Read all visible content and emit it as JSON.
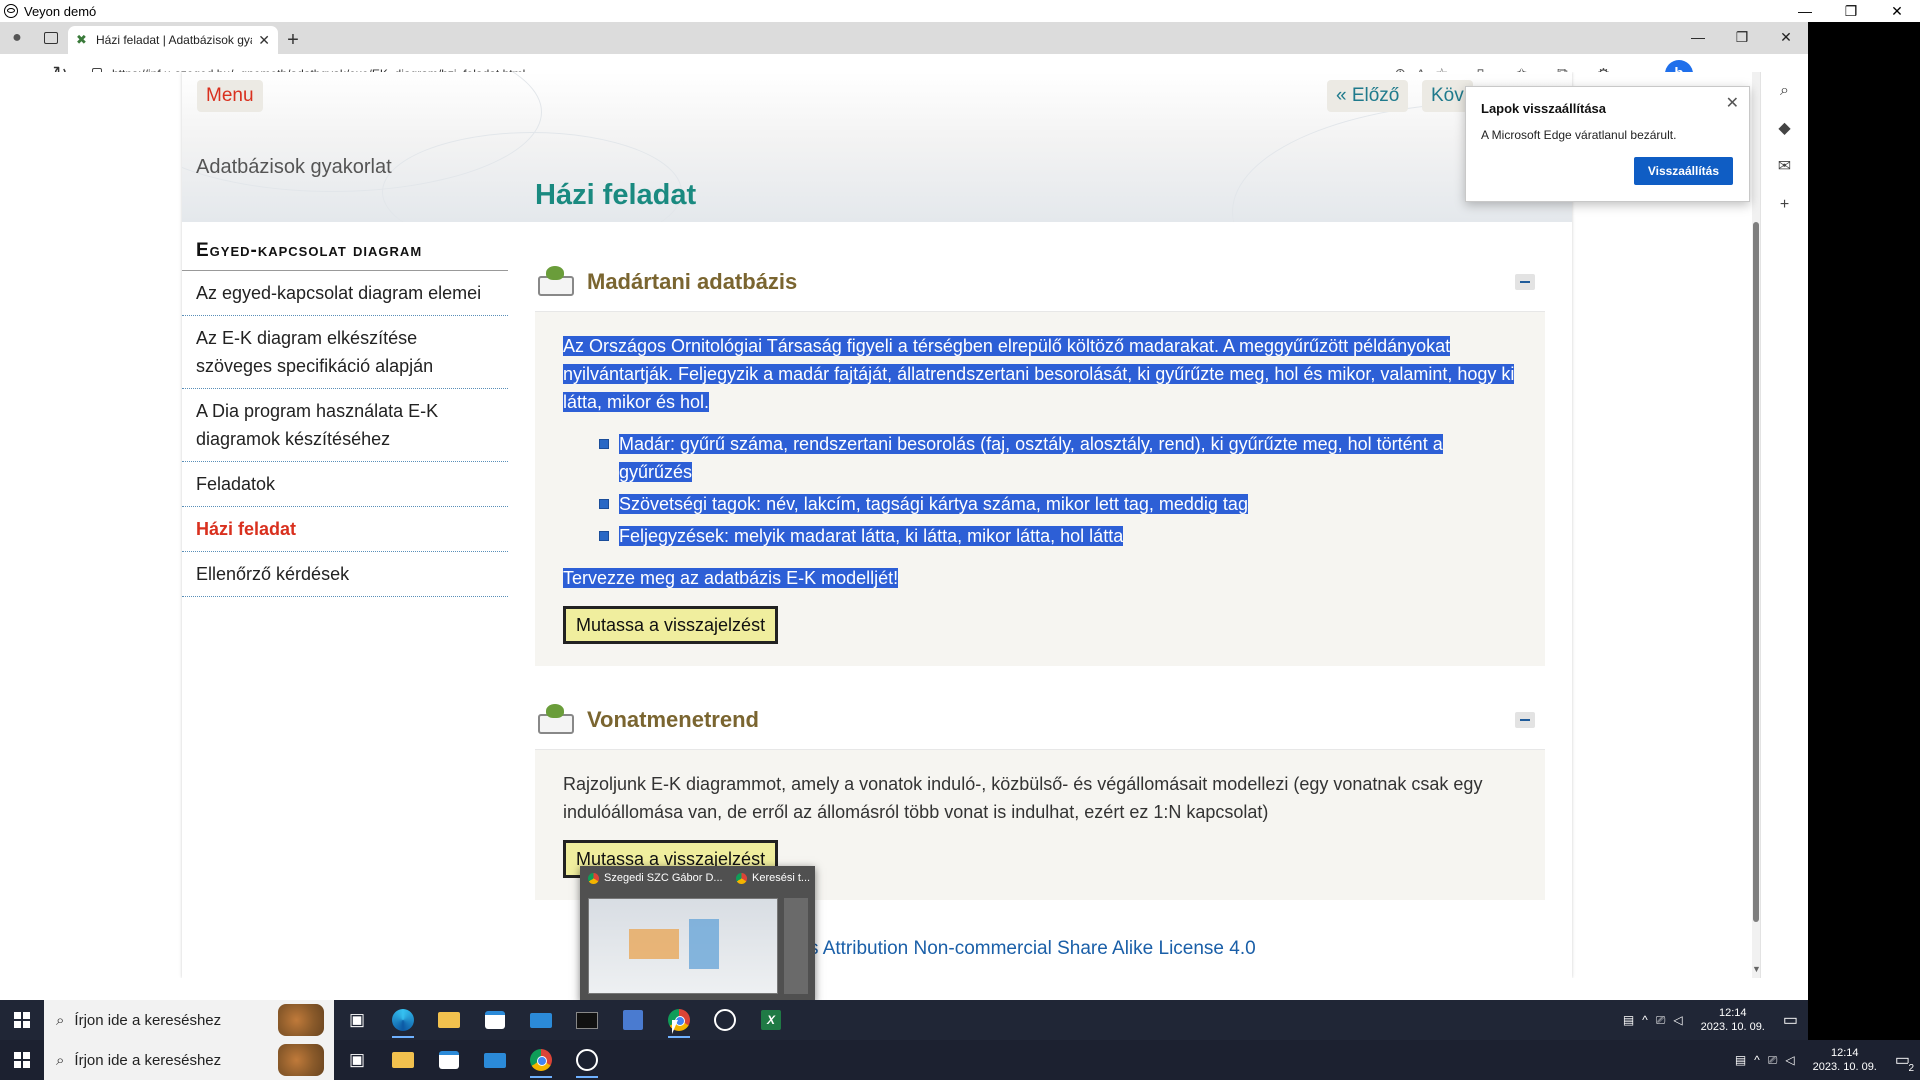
{
  "veyon": {
    "title": "Veyon demó",
    "min": "—",
    "restore": "❐",
    "close": "✕"
  },
  "browser": {
    "tab_title": "Házi feladat | Adatbázisok gyako",
    "url": "https://inf.u-szeged.hu/~gnemeth/adatbgyak/exe/EK_diagram/hzi_feladat.html"
  },
  "page": {
    "menu_label": "Menu",
    "prev_label": "« Előző",
    "next_label": "Köv",
    "site_title": "Adatbázisok gyakorlat",
    "title": "Házi feladat"
  },
  "sidebar": {
    "heading": "Egyed-kapcsolat diagram",
    "items": [
      {
        "label": "Az egyed-kapcsolat diagram elemei"
      },
      {
        "label": "Az E-K diagram elkészítése szöveges specifikáció alapján"
      },
      {
        "label": "A Dia program használata E-K diagramok készítéséhez"
      },
      {
        "label": "Feladatok"
      },
      {
        "label": "Házi feladat"
      },
      {
        "label": "Ellenőrző kérdések"
      }
    ]
  },
  "sections": [
    {
      "title": "Madártani adatbázis",
      "intro": "Az Országos Ornitológiai Társaság figyeli a térségben elrepülő költöző madarakat. A meggyűrűzött példányokat nyilvántartják. Feljegyzik a madár fajtáját, állatrendszertani besorolását, ki gyűrűzte meg, hol és mikor, valamint, hogy ki látta, mikor és hol.",
      "bullets": [
        "Madár: gyűrű száma, rendszertani besorolás (faj, osztály, alosztály, rend), ki gyűrűzte meg, hol történt a gyűrűzés",
        "Szövetségi tagok: név, lakcím, tagsági kártya száma, mikor lett tag, meddig tag",
        "Feljegyzések: melyik madarat látta, ki látta, mikor látta, hol látta"
      ],
      "task": "Tervezze meg az adatbázis E-K modelljét!",
      "button": "Mutassa a visszajelzést"
    },
    {
      "title": "Vonatmenetrend",
      "intro": "Rajzoljunk E-K diagrammot, amely a vonatok induló-, közbülső- és végállomásait modellezi (egy vonatnak csak egy indulóállomása van, de erről az állomásról több vonat is indulhat, ezért ez 1:N kapcsolat)",
      "button": "Mutassa a visszajelzést"
    }
  ],
  "license": {
    "prefix": "e",
    "link": "Creative Commons Attribution Non-commercial Share Alike License 4.0"
  },
  "restore_popup": {
    "title": "Lapok visszaállítása",
    "message": "A Microsoft Edge váratlanul bezárult.",
    "button": "Visszaállítás"
  },
  "thumbnail_popup": {
    "tab1": "Szegedi SZC Gábor D...",
    "tab2": "Keresési t..."
  },
  "taskbar": {
    "search_placeholder": "Írjon ide a kereséshez",
    "time": "12:14",
    "date": "2023. 10. 09.",
    "notifications": "2"
  },
  "icons": [
    "windows-icon",
    "search-icon",
    "task-view-icon",
    "edge-icon",
    "file-explorer-icon",
    "store-icon",
    "mail-icon",
    "terminal-icon",
    "save-icon",
    "chrome-icon",
    "veyon-icon",
    "excel-icon"
  ],
  "colors": {
    "accent_red": "#d9301e",
    "title_teal": "#1a8a80",
    "selection": "#2d5fd6",
    "edge_blue": "#0f5dc4"
  }
}
